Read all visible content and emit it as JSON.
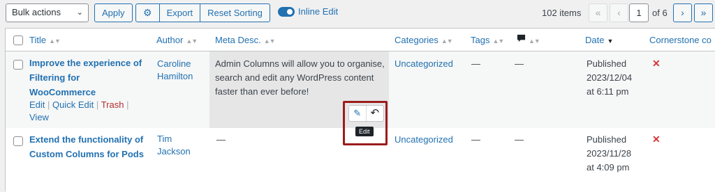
{
  "toolbar": {
    "bulk_actions": "Bulk actions",
    "apply": "Apply",
    "export": "Export",
    "reset_sorting": "Reset Sorting",
    "inline_edit": "Inline Edit",
    "items_count": "102 items",
    "first_page": "«",
    "prev_page": "‹",
    "current_page": "1",
    "of_pages": "of 6",
    "next_page": "›",
    "last_page": "»"
  },
  "columns": {
    "title": "Title",
    "author": "Author",
    "meta_desc": "Meta Desc.",
    "categories": "Categories",
    "tags": "Tags",
    "date": "Date",
    "cornerstone": "Cornerstone co"
  },
  "rows": [
    {
      "title_lines": [
        "Improve the experience of",
        "Filtering for",
        "WooCommerce"
      ],
      "author_lines": [
        "Caroline",
        "Hamilton"
      ],
      "meta_lines": [
        "Admin Columns will allow you to organise,",
        "search and edit any WordPress content",
        "faster than ever before!"
      ],
      "category": "Uncategorized",
      "tags": "—",
      "comments": "—",
      "date_lines": [
        "Published",
        "2023/12/04",
        "at 6:11 pm"
      ],
      "cornerstone": "✕",
      "actions": {
        "edit": "Edit",
        "quick_edit": "Quick Edit",
        "trash": "Trash",
        "view": "View",
        "sep": "|"
      }
    },
    {
      "title_lines": [
        "Extend the functionality of",
        "Custom Columns for Pods"
      ],
      "author_lines": [
        "Tim",
        "Jackson"
      ],
      "meta": "—",
      "category": "Uncategorized",
      "tags": "—",
      "comments": "—",
      "date_lines": [
        "Published",
        "2023/11/28",
        "at 4:09 pm"
      ],
      "cornerstone": "✕"
    }
  ],
  "inline_edit": {
    "tooltip": "Edit"
  },
  "icons": {
    "settings": "gear-icon",
    "comments": "comment-bubble-icon",
    "edit": "pencil-icon",
    "undo": "undo-icon"
  },
  "colors": {
    "link": "#2271b1",
    "danger": "#d63638",
    "highlight": "#9b1c1c"
  }
}
